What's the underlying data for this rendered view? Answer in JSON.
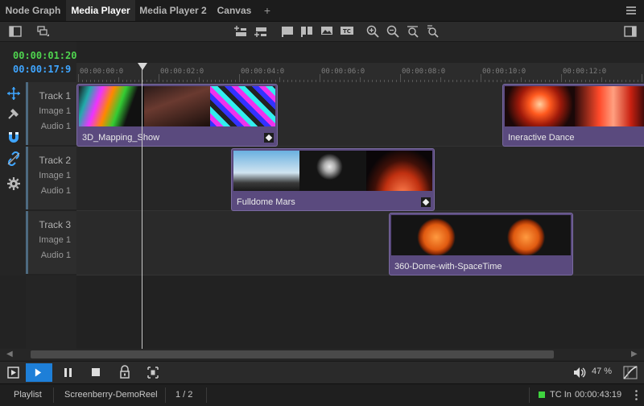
{
  "tabs": [
    {
      "label": "Node Graph",
      "active": false
    },
    {
      "label": "Media Player",
      "active": true
    },
    {
      "label": "Media Player 2",
      "active": false
    },
    {
      "label": "Canvas",
      "active": false
    }
  ],
  "tab_add": "+",
  "timecodes": {
    "current": "00:00:01:20",
    "secondary": "00:00:17:9"
  },
  "ruler": {
    "labels": [
      "00:00:00:0",
      "00:00:02:0",
      "00:00:04:0",
      "00:00:06:0",
      "00:00:08:0",
      "00:00:10:0",
      "00:00:12:0"
    ]
  },
  "tracks": [
    {
      "name": "Track 1",
      "image": "Image 1",
      "audio": "Audio 1"
    },
    {
      "name": "Track 2",
      "image": "Image 1",
      "audio": "Audio 1"
    },
    {
      "name": "Track 3",
      "image": "Image 1",
      "audio": "Audio 1"
    }
  ],
  "clips": [
    {
      "name": "3D_Mapping_Show"
    },
    {
      "name": "Ineractive Dance"
    },
    {
      "name": "Fulldome Mars"
    },
    {
      "name": "360-Dome-with-SpaceTime"
    }
  ],
  "volume": {
    "percent": "47 %"
  },
  "status": {
    "playlist": "Playlist",
    "project": "Screenberry-DemoReel",
    "page": "1 / 2",
    "tc_label": "TC In",
    "tc_value": "00:00:43:19"
  },
  "colors": {
    "accent": "#1e7fd8",
    "clip": "#5a4a7e",
    "tc_green": "#4fd44f",
    "tc_blue": "#3fa5ff"
  }
}
